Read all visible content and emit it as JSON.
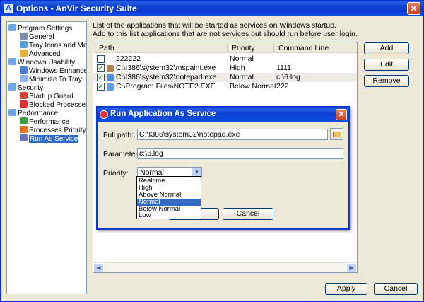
{
  "window": {
    "title": "Options - AnVir Security Suite",
    "close_glyph": "✕"
  },
  "tree": {
    "items": [
      {
        "label": "Program Settings",
        "level": 0,
        "icon": "folder-icon"
      },
      {
        "label": "General",
        "level": 1,
        "icon": "settings-icon"
      },
      {
        "label": "Tray Icons and Menu",
        "level": 1,
        "icon": "tray-icon"
      },
      {
        "label": "Advanced",
        "level": 1,
        "icon": "advanced-icon"
      },
      {
        "label": "Windows Usability",
        "level": 0,
        "icon": "folder-icon"
      },
      {
        "label": "Windows Enhancem",
        "level": 1,
        "icon": "window-icon"
      },
      {
        "label": "Minimize To Tray",
        "level": 1,
        "icon": "minimize-icon"
      },
      {
        "label": "Security",
        "level": 0,
        "icon": "folder-icon"
      },
      {
        "label": "Startup Guard",
        "level": 1,
        "icon": "shield-icon"
      },
      {
        "label": "Blocked Processes",
        "level": 1,
        "icon": "blocked-icon"
      },
      {
        "label": "Performance",
        "level": 0,
        "icon": "folder-icon"
      },
      {
        "label": "Performance",
        "level": 1,
        "icon": "performance-icon"
      },
      {
        "label": "Processes Priority",
        "level": 1,
        "icon": "priority-icon"
      },
      {
        "label": "Run As Service",
        "level": 1,
        "icon": "service-icon",
        "selected": true
      }
    ]
  },
  "description": {
    "line1": "List of the applications that will be started as services on Windows startup.",
    "line2": "Add to this list applications that are not services but should run before user login."
  },
  "list": {
    "columns": [
      "Path",
      "Priority",
      "Command Line"
    ],
    "rows": [
      {
        "checked": false,
        "path": "222222",
        "priority": "Normal",
        "cmd": "",
        "icon": "none"
      },
      {
        "checked": true,
        "path": "C:\\I386\\system32\\mspaint.exe",
        "priority": "High",
        "cmd": "1111",
        "icon": "paint-icon"
      },
      {
        "checked": true,
        "path": "C:\\I386\\system32\\notepad.exe",
        "priority": "Normal",
        "cmd": "c:\\6.log",
        "icon": "notepad-icon",
        "selected": true
      },
      {
        "checked": true,
        "path": "C:\\Program Files\\NOTE2.EXE",
        "priority": "Below Normal",
        "cmd": "222",
        "icon": "exe-icon"
      }
    ],
    "check_glyph": "✓"
  },
  "buttons": {
    "add": "Add",
    "edit": "Edit",
    "remove": "Remove",
    "apply": "Apply",
    "cancel": "Cancel"
  },
  "dialog": {
    "title": "Run Application As Service",
    "close_glyph": "✕",
    "full_path_label": "Full path:",
    "full_path_value": "C:\\I386\\system32\\notepad.exe",
    "parameters_label": "Parameters:",
    "parameters_value": "c:\\6.log",
    "priority_label": "Priority:",
    "priority_value": "Normal",
    "priority_options": [
      "Realtime",
      "High",
      "Above Normal",
      "Normal",
      "Below Normal",
      "Low"
    ],
    "priority_highlighted": "Normal",
    "cancel": "Cancel"
  },
  "colors": {
    "titlebar": "#0a3fcf",
    "selection": "#316ac5",
    "panel": "#ece9d8"
  }
}
